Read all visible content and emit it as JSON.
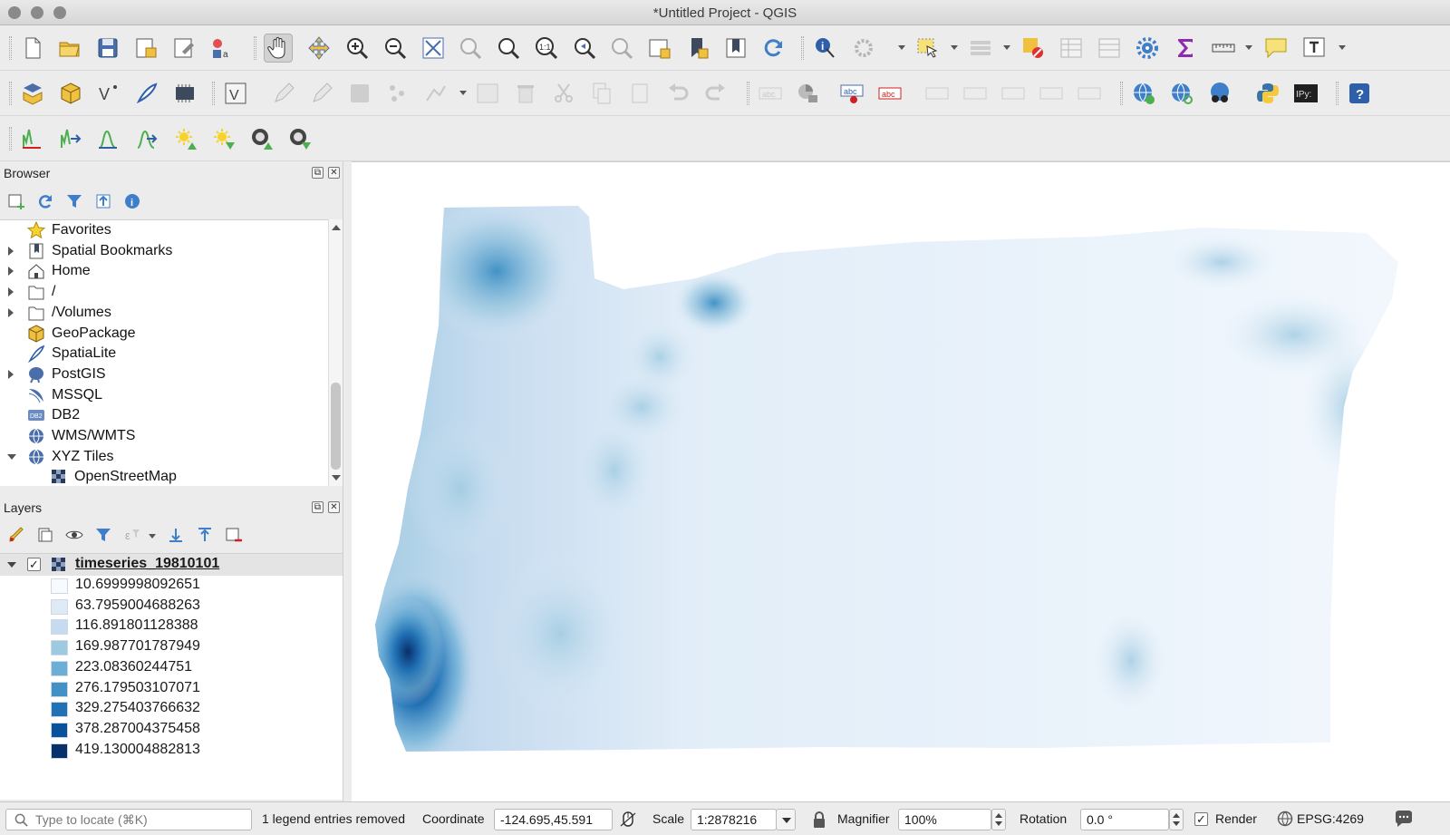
{
  "window": {
    "title": "*Untitled Project - QGIS"
  },
  "browser": {
    "title": "Browser",
    "items": [
      {
        "label": "Favorites",
        "icon": "star-icon",
        "expandable": false
      },
      {
        "label": "Spatial Bookmarks",
        "icon": "bookmark-icon",
        "expandable": true
      },
      {
        "label": "Home",
        "icon": "home-icon",
        "expandable": true
      },
      {
        "label": "/",
        "icon": "folder-icon",
        "expandable": true
      },
      {
        "label": "/Volumes",
        "icon": "folder-icon",
        "expandable": true
      },
      {
        "label": "GeoPackage",
        "icon": "geopackage-icon",
        "expandable": false
      },
      {
        "label": "SpatiaLite",
        "icon": "spatialite-icon",
        "expandable": false
      },
      {
        "label": "PostGIS",
        "icon": "postgis-icon",
        "expandable": true
      },
      {
        "label": "MSSQL",
        "icon": "mssql-icon",
        "expandable": false
      },
      {
        "label": "DB2",
        "icon": "db2-icon",
        "expandable": false
      },
      {
        "label": "WMS/WMTS",
        "icon": "globe-icon",
        "expandable": false
      },
      {
        "label": "XYZ Tiles",
        "icon": "globe-icon",
        "expandable": true,
        "expanded": true
      },
      {
        "label": "OpenStreetMap",
        "icon": "raster-tile-icon",
        "expandable": false,
        "child": true
      }
    ]
  },
  "layers": {
    "title": "Layers",
    "layer": {
      "name": "timeseries_19810101",
      "visible": true,
      "legend": [
        {
          "value": "10.6999998092651",
          "color": "#f7fbff"
        },
        {
          "value": "63.7959004688263",
          "color": "#deebf7"
        },
        {
          "value": "116.891801128388",
          "color": "#c6dbef"
        },
        {
          "value": "169.987701787949",
          "color": "#9ecae1"
        },
        {
          "value": "223.08360244751",
          "color": "#6baed6"
        },
        {
          "value": "276.179503107071",
          "color": "#4292c6"
        },
        {
          "value": "329.275403766632",
          "color": "#2171b5"
        },
        {
          "value": "378.287004375458",
          "color": "#08519c"
        },
        {
          "value": "419.130004882813",
          "color": "#08306b"
        }
      ]
    }
  },
  "statusbar": {
    "locate_placeholder": "Type to locate (⌘K)",
    "message": "1 legend entries removed",
    "coordinate_label": "Coordinate",
    "coordinate_value": "-124.695,45.591",
    "scale_label": "Scale",
    "scale_value": "1:2878216",
    "magnifier_label": "Magnifier",
    "magnifier_value": "100%",
    "rotation_label": "Rotation",
    "rotation_value": "0.0 °",
    "render_label": "Render",
    "render_checked": true,
    "crs": "EPSG:4269"
  },
  "colors": {
    "map_ramp_light": "#f7fbff",
    "map_ramp_dark": "#08306b"
  }
}
